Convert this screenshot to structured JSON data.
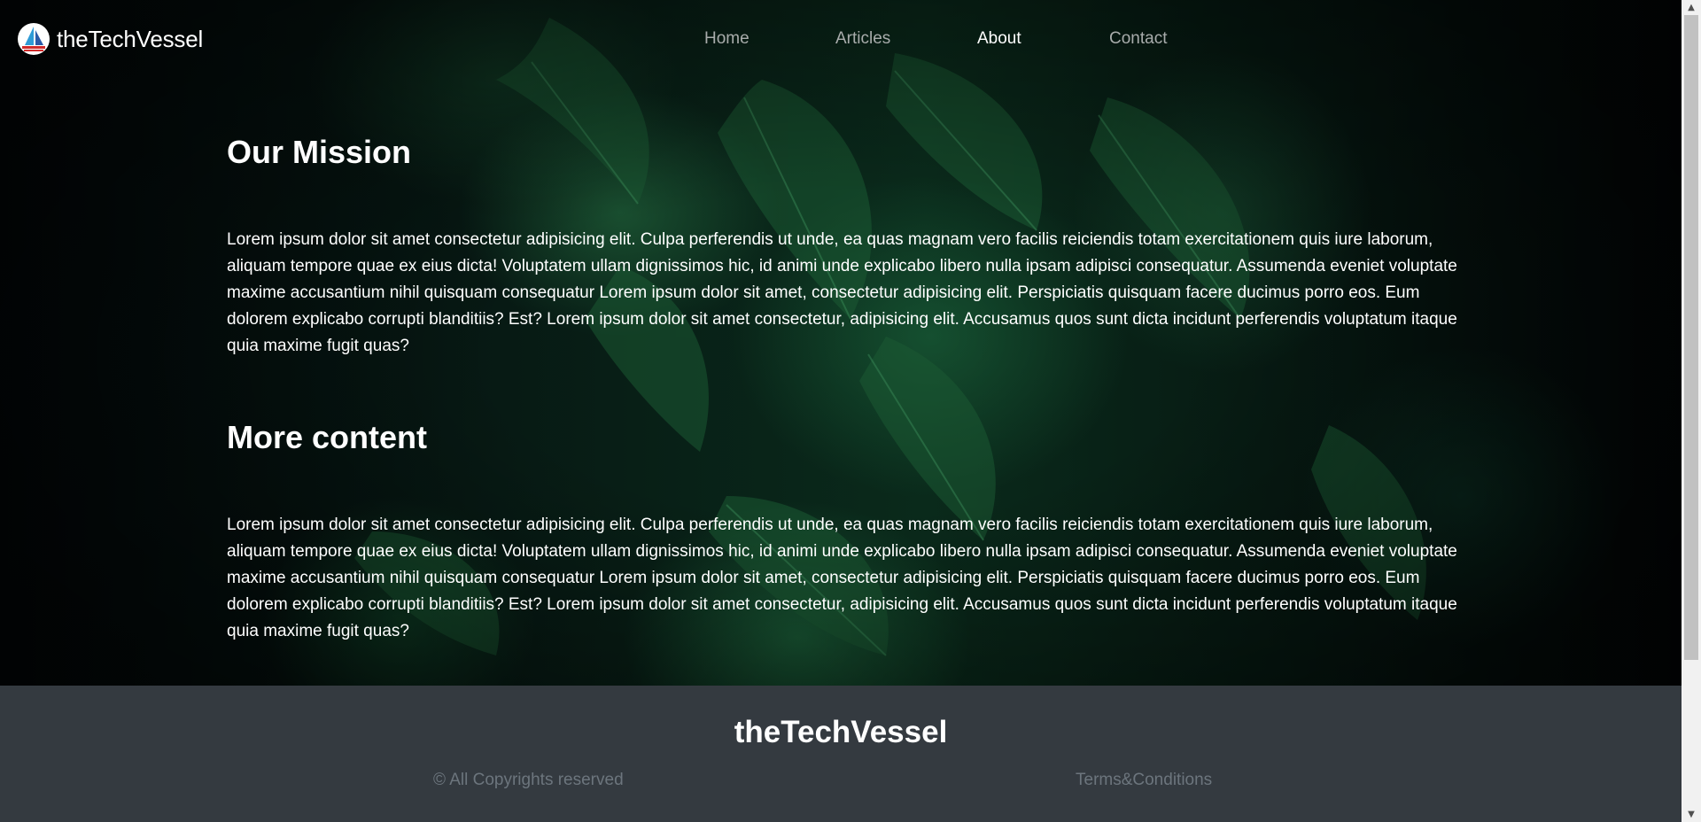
{
  "header": {
    "brand": "theTechVessel",
    "nav": [
      {
        "label": "Home",
        "active": false
      },
      {
        "label": "Articles",
        "active": false
      },
      {
        "label": "About",
        "active": true
      },
      {
        "label": "Contact",
        "active": false
      }
    ]
  },
  "main": {
    "sections": [
      {
        "heading": "Our Mission",
        "body": "Lorem ipsum dolor sit amet consectetur adipisicing elit. Culpa perferendis ut unde, ea quas magnam vero facilis reiciendis totam exercitationem quis iure laborum, aliquam tempore quae ex eius dicta! Voluptatem ullam dignissimos hic, id animi unde explicabo libero nulla ipsam adipisci consequatur. Assumenda eveniet voluptate maxime accusantium nihil quisquam consequatur Lorem ipsum dolor sit amet, consectetur adipisicing elit. Perspiciatis quisquam facere ducimus porro eos. Eum dolorem explicabo corrupti blanditiis? Est? Lorem ipsum dolor sit amet consectetur, adipisicing elit. Accusamus quos sunt dicta incidunt perferendis voluptatum itaque quia maxime fugit quas?"
      },
      {
        "heading": "More content",
        "body": "Lorem ipsum dolor sit amet consectetur adipisicing elit. Culpa perferendis ut unde, ea quas magnam vero facilis reiciendis totam exercitationem quis iure laborum, aliquam tempore quae ex eius dicta! Voluptatem ullam dignissimos hic, id animi unde explicabo libero nulla ipsam adipisci consequatur. Assumenda eveniet voluptate maxime accusantium nihil quisquam consequatur Lorem ipsum dolor sit amet, consectetur adipisicing elit. Perspiciatis quisquam facere ducimus porro eos. Eum dolorem explicabo corrupti blanditiis? Est? Lorem ipsum dolor sit amet consectetur, adipisicing elit. Accusamus quos sunt dicta incidunt perferendis voluptatum itaque quia maxime fugit quas?"
      }
    ]
  },
  "footer": {
    "brand": "theTechVessel",
    "copyright": "© All Copyrights reserved",
    "terms": "Terms&Conditions"
  },
  "colors": {
    "footer_bg": "#343a40",
    "muted_text": "#6c757d",
    "nav_inactive": "#a8acab",
    "leaf_green": "#1f6b3c"
  },
  "icons": {
    "logo": "sailboat-logo-icon",
    "scroll_up": "scroll-up-arrow-icon",
    "scroll_down": "scroll-down-arrow-icon"
  }
}
